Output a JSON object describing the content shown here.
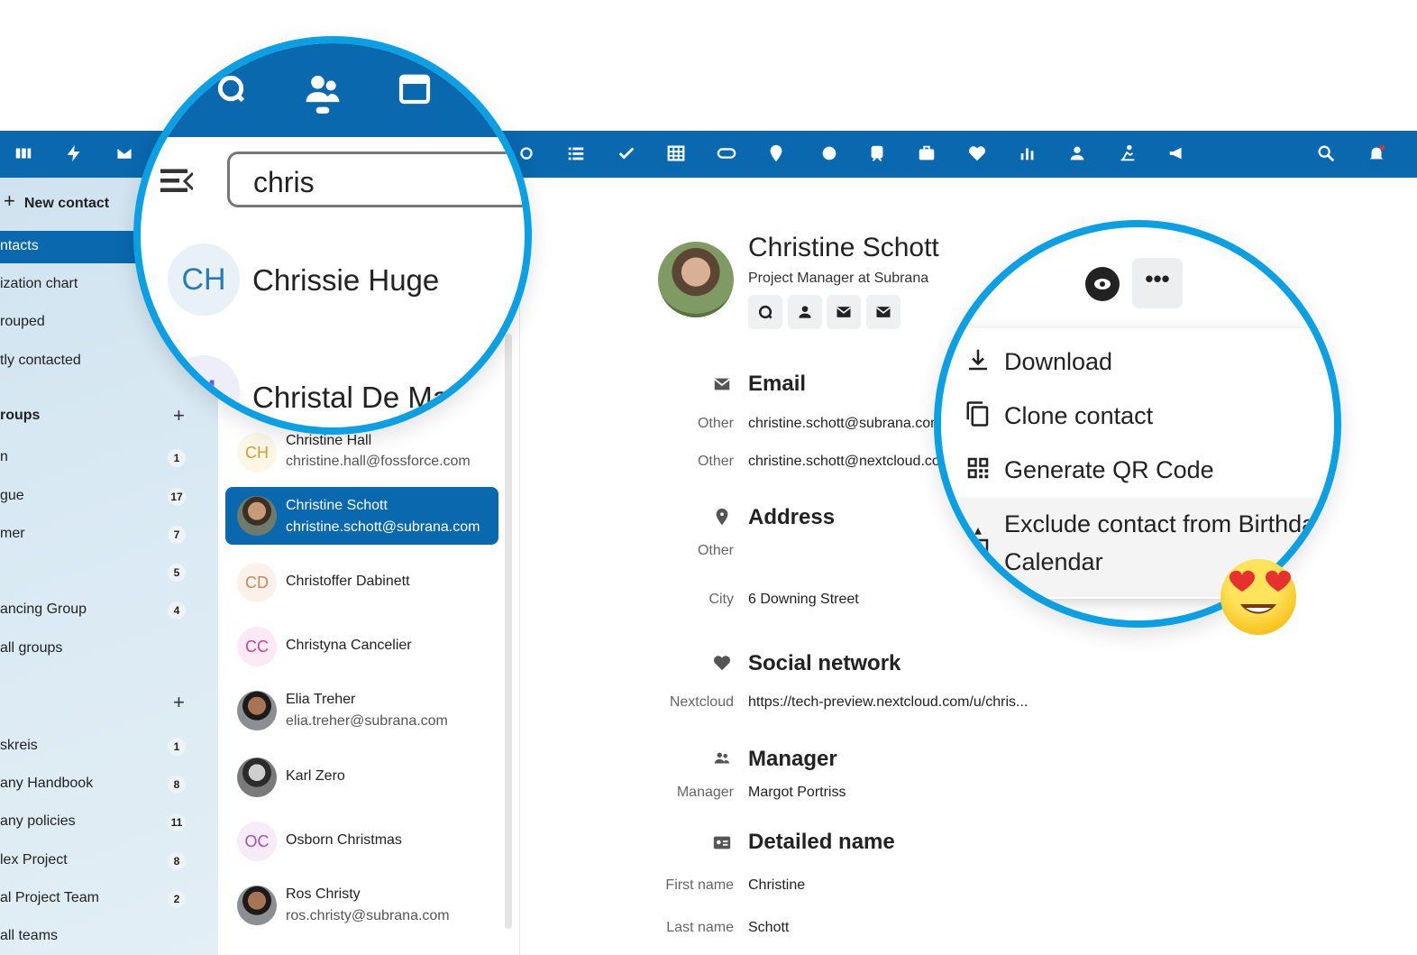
{
  "search": {
    "query": "chris"
  },
  "sidebar": {
    "new_contact": "New contact",
    "items": [
      {
        "label": "ntacts",
        "active": true
      },
      {
        "label": "ization chart"
      },
      {
        "label": "rouped"
      },
      {
        "label": "tly contacted"
      }
    ],
    "groups_title": "roups",
    "groups": [
      {
        "label": "n",
        "count": "1"
      },
      {
        "label": "gue",
        "count": "17"
      },
      {
        "label": "mer",
        "count": "7"
      },
      {
        "label": "",
        "count": "5"
      },
      {
        "label": "ancing Group",
        "count": "4"
      },
      {
        "label": "all groups",
        "count": ""
      }
    ],
    "teams": [
      {
        "label": "skreis",
        "count": "1"
      },
      {
        "label": "any Handbook",
        "count": "8"
      },
      {
        "label": "any policies",
        "count": "11"
      },
      {
        "label": "lex Project",
        "count": "8"
      },
      {
        "label": "al Project Team",
        "count": "2"
      },
      {
        "label": "all teams",
        "count": ""
      }
    ]
  },
  "contacts": [
    {
      "initials": "CH",
      "name": "Christine Hall",
      "email": "christine.hall@fossforce.com"
    },
    {
      "initials": "",
      "name": "Christine Schott",
      "email": "christine.schott@subrana.com",
      "selected": true
    },
    {
      "initials": "CD",
      "name": "Christoffer Dabinett",
      "email": ""
    },
    {
      "initials": "CC",
      "name": "Christyna Cancelier",
      "email": ""
    },
    {
      "initials": "",
      "name": "Elia Treher",
      "email": "elia.treher@subrana.com"
    },
    {
      "initials": "",
      "name": "Karl Zero",
      "email": ""
    },
    {
      "initials": "OC",
      "name": "Osborn Christmas",
      "email": ""
    },
    {
      "initials": "",
      "name": "Ros Christy",
      "email": "ros.christy@subrana.com"
    }
  ],
  "lens_contacts": [
    {
      "initials": "CH",
      "name": "Chrissie Huge"
    },
    {
      "initials": "M",
      "name": "Christal De Maria"
    }
  ],
  "detail": {
    "name": "Christine Schott",
    "subtitle": "Project Manager at Subrana",
    "sections": {
      "email": {
        "title": "Email",
        "rows": [
          {
            "label": "Other",
            "value": "christine.schott@subrana.com"
          },
          {
            "label": "Other",
            "value": "christine.schott@nextcloud.com"
          }
        ]
      },
      "address": {
        "title": "Address",
        "rows": [
          {
            "label": "Other",
            "value": ""
          },
          {
            "label": "City",
            "value": "6 Downing Street"
          }
        ]
      },
      "social": {
        "title": "Social network",
        "rows": [
          {
            "label": "Nextcloud",
            "value": "https://tech-preview.nextcloud.com/u/chris..."
          }
        ]
      },
      "manager": {
        "title": "Manager",
        "rows": [
          {
            "label": "Manager",
            "value": "Margot Portriss"
          }
        ]
      },
      "detailed_name": {
        "title": "Detailed name",
        "rows": [
          {
            "label": "First name",
            "value": "Christine"
          },
          {
            "label": "Last name",
            "value": "Schott"
          }
        ]
      }
    }
  },
  "menu": {
    "items": [
      {
        "label": "Download",
        "icon": "download-icon"
      },
      {
        "label": "Clone contact",
        "icon": "copy-icon"
      },
      {
        "label": "Generate QR Code",
        "icon": "qr-code-icon"
      },
      {
        "label": "Exclude contact from Birthday",
        "label2": "Calendar",
        "icon": "cake-icon"
      }
    ],
    "more_label": "•••"
  },
  "colors": {
    "primary": "#0a68ae",
    "accent": "#0b9fe3"
  }
}
